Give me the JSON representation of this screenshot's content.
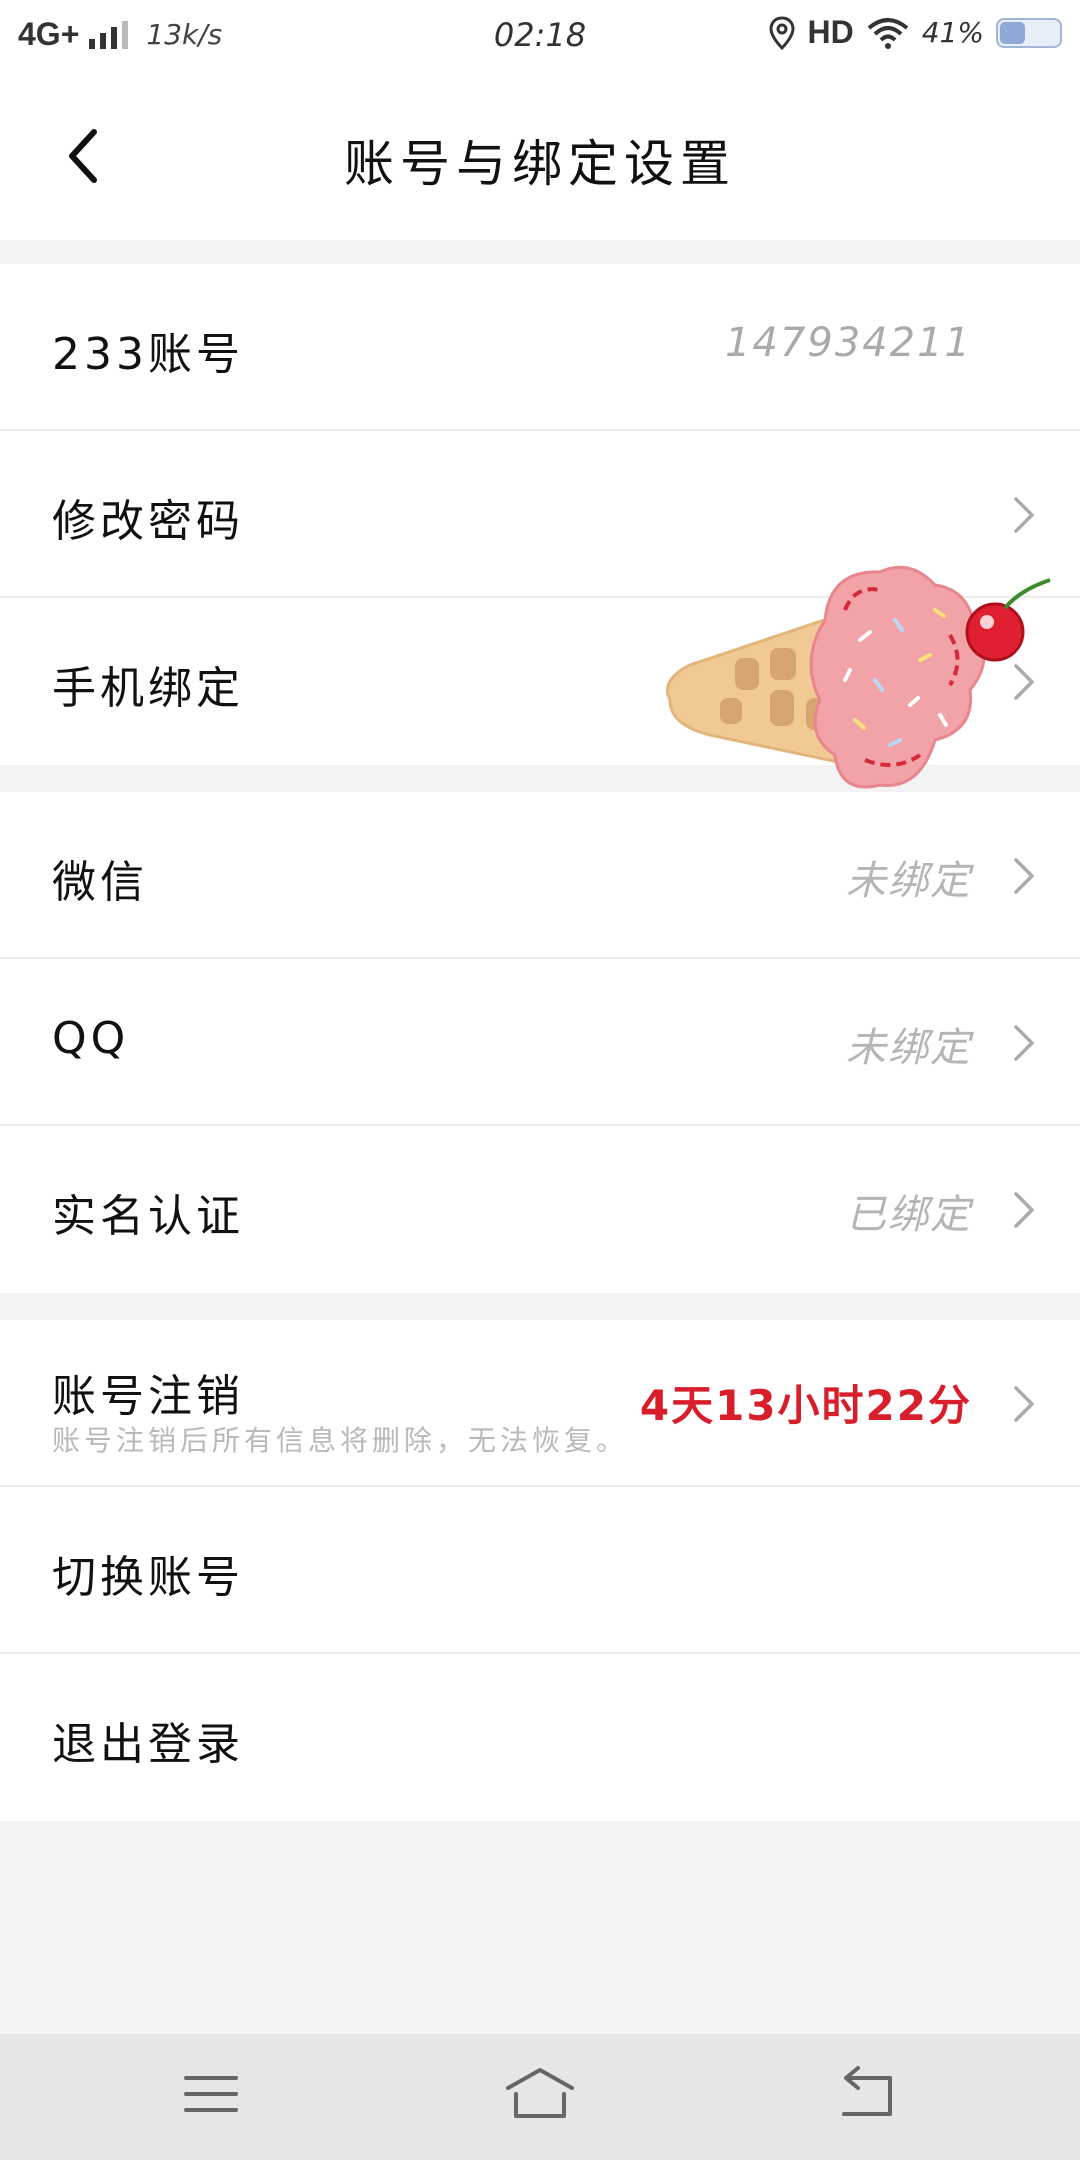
{
  "status_bar": {
    "network": "4G+",
    "speed": "13k/s",
    "time": "02:18",
    "hd": "HD",
    "battery": "41%"
  },
  "header": {
    "title": "账号与绑定设置"
  },
  "account_section": {
    "account_label": "233账号",
    "account_value": "147934211",
    "password_label": "修改密码",
    "phone_label": "手机绑定"
  },
  "binding_section": {
    "wechat_label": "微信",
    "wechat_status": "未绑定",
    "qq_label": "QQ",
    "qq_status": "未绑定",
    "realname_label": "实名认证",
    "realname_status": "已绑定"
  },
  "account_actions": {
    "cancel_label": "账号注销",
    "cancel_desc": "账号注销后所有信息将删除，无法恢复。",
    "cancel_countdown": "4天13小时22分",
    "switch_label": "切换账号",
    "logout_label": "退出登录"
  },
  "colors": {
    "countdown_red": "#d81e2a",
    "secondary_gray": "#b5b5b5",
    "background": "#f3f3f3"
  }
}
